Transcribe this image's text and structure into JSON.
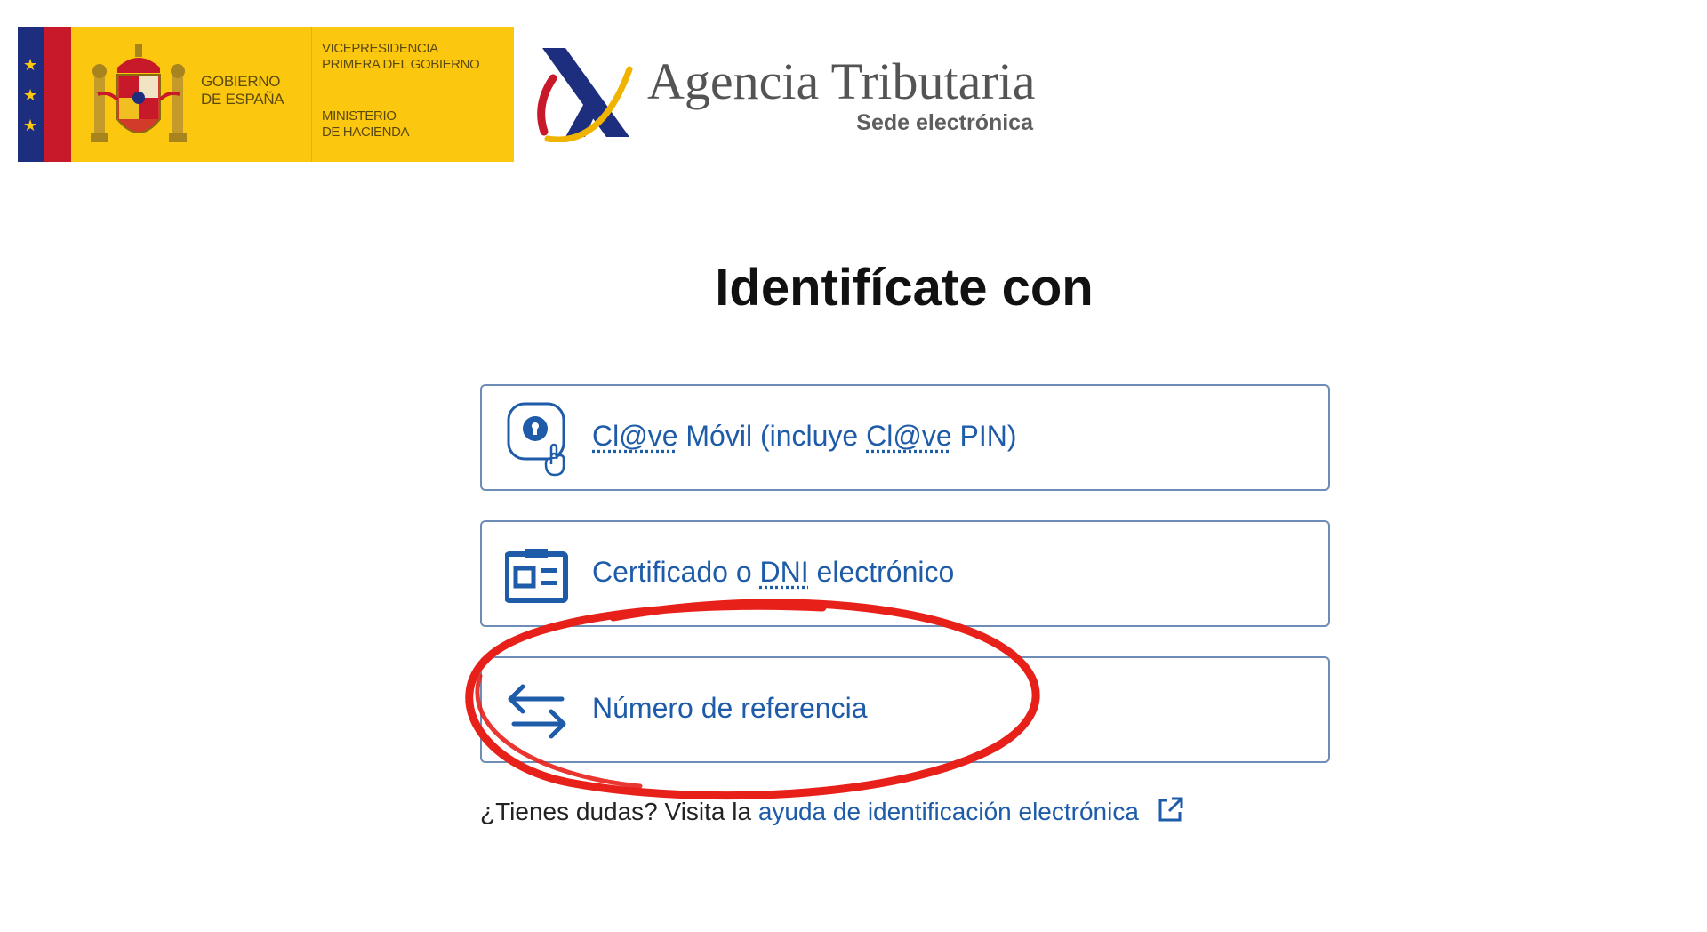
{
  "header": {
    "gov": {
      "name_line1": "GOBIERNO",
      "name_line2": "DE ESPAÑA",
      "vice_line1": "VICEPRESIDENCIA",
      "vice_line2": "PRIMERA DEL GOBIERNO",
      "ministry_line1": "MINISTERIO",
      "ministry_line2": "DE HACIENDA"
    },
    "aeat": {
      "title": "Agencia Tributaria",
      "subtitle": "Sede electrónica"
    }
  },
  "main": {
    "heading": "Identifícate con",
    "options": [
      {
        "icon": "clave-movil-icon",
        "label_part1": "Cl@ve",
        "label_part2": " Móvil (incluye ",
        "label_part3": "Cl@ve",
        "label_part4": " PIN)"
      },
      {
        "icon": "id-card-icon",
        "label_part1": "Certificado o ",
        "label_part2": "DNI",
        "label_part3": " electrónico"
      },
      {
        "icon": "arrows-exchange-icon",
        "label": "Número de referencia"
      }
    ],
    "help": {
      "prefix": "¿Tienes dudas? Visita la ",
      "link": "ayuda de identificación electrónica",
      "icon": "external-link-icon"
    }
  },
  "colors": {
    "accent": "#1e5ba8",
    "border": "#6e8cb8",
    "gov_yellow": "#fcc70f",
    "annotation_red": "#e8201a"
  }
}
